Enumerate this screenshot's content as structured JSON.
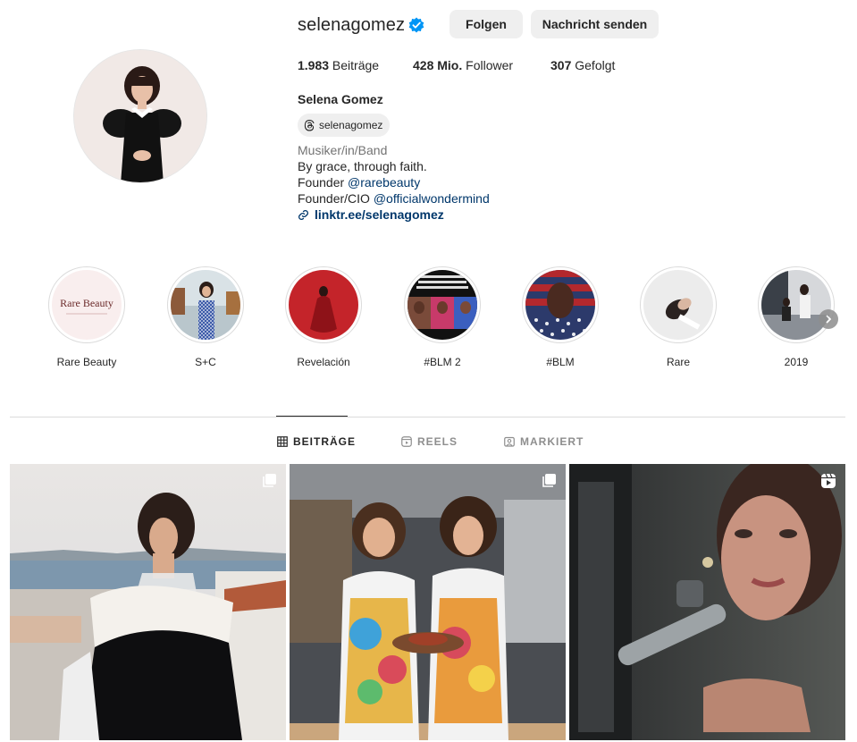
{
  "profile": {
    "username": "selenagomez",
    "verified": true,
    "follow_label": "Folgen",
    "message_label": "Nachricht senden",
    "stats": {
      "posts": "1.983",
      "posts_label": " Beiträge",
      "followers": "428 Mio.",
      "followers_label": " Follower",
      "following": "307",
      "following_label": " Gefolgt"
    },
    "full_name": "Selena Gomez",
    "threads_handle": "selenagomez",
    "category": "Musiker/in/Band",
    "bio_lines": {
      "line1": "By grace, through faith.",
      "line2_prefix": "Founder ",
      "line2_mention": "@rarebeauty",
      "line3_prefix": "Founder/CIO ",
      "line3_mention": "@officialwondermind"
    },
    "link": "linktr.ee/selenagomez"
  },
  "highlights": [
    {
      "label": "Rare Beauty",
      "logo_text": "Rare Beauty"
    },
    {
      "label": "S+C"
    },
    {
      "label": "Revelación"
    },
    {
      "label": "#BLM 2"
    },
    {
      "label": "#BLM"
    },
    {
      "label": "Rare"
    },
    {
      "label": "2019"
    }
  ],
  "tabs": [
    {
      "label": "BEITRÄGE",
      "active": true,
      "icon": "grid-icon"
    },
    {
      "label": "REELS",
      "active": false,
      "icon": "reels-icon"
    },
    {
      "label": "MARKIERT",
      "active": false,
      "icon": "tagged-icon"
    }
  ],
  "posts": [
    {
      "badge": "carousel-icon"
    },
    {
      "badge": "carousel-icon"
    },
    {
      "badge": "reel-icon"
    }
  ],
  "colors": {
    "verified_blue": "#0095f6",
    "link_blue": "#00376b",
    "button_gray": "#efefef",
    "text": "#262626",
    "muted": "#737373"
  }
}
